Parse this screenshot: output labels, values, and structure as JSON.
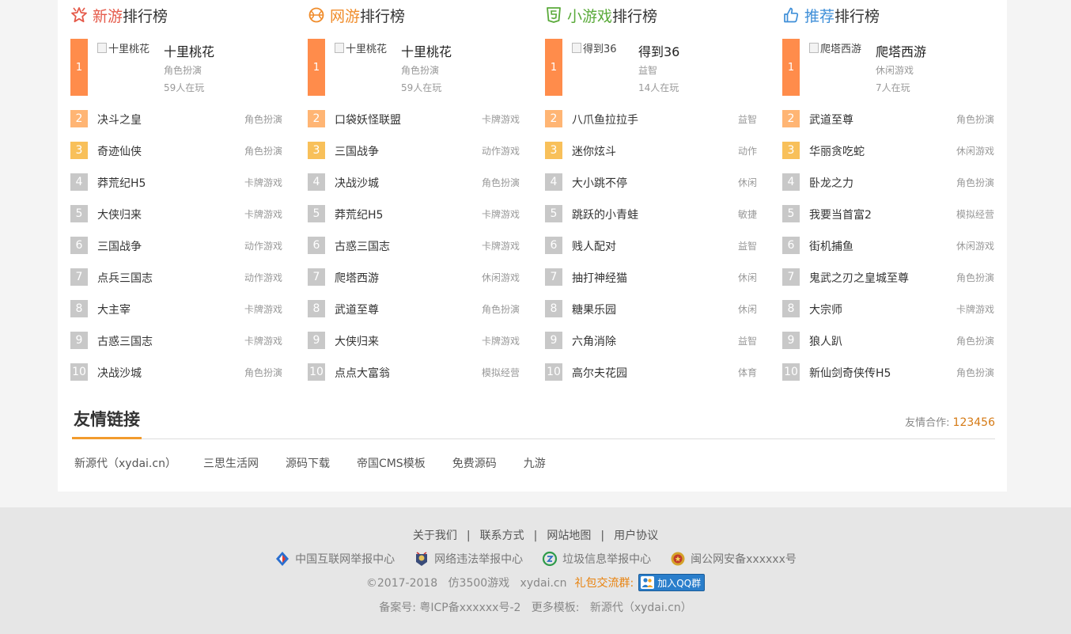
{
  "columns": [
    {
      "title_highlight": "新游",
      "title_rest": "排行榜",
      "highlight_color": "#e55a4a",
      "icon": "star-icon",
      "top": {
        "rank": "1",
        "img_alt": "十里桃花",
        "name": "十里桃花",
        "category": "角色扮演",
        "players": "59人在玩"
      },
      "items": [
        {
          "rank": "2",
          "name": "决斗之皇",
          "category": "角色扮演"
        },
        {
          "rank": "3",
          "name": "奇迹仙侠",
          "category": "角色扮演"
        },
        {
          "rank": "4",
          "name": "莽荒纪H5",
          "category": "卡牌游戏"
        },
        {
          "rank": "5",
          "name": "大侠归来",
          "category": "卡牌游戏"
        },
        {
          "rank": "6",
          "name": "三国战争",
          "category": "动作游戏"
        },
        {
          "rank": "7",
          "name": "点兵三国志",
          "category": "动作游戏"
        },
        {
          "rank": "8",
          "name": "大主宰",
          "category": "卡牌游戏"
        },
        {
          "rank": "9",
          "name": "古惑三国志",
          "category": "卡牌游戏"
        },
        {
          "rank": "10",
          "name": "决战沙城",
          "category": "角色扮演"
        }
      ]
    },
    {
      "title_highlight": "网游",
      "title_rest": "排行榜",
      "highlight_color": "#f08c2a",
      "icon": "basketball-icon",
      "top": {
        "rank": "1",
        "img_alt": "十里桃花",
        "name": "十里桃花",
        "category": "角色扮演",
        "players": "59人在玩"
      },
      "items": [
        {
          "rank": "2",
          "name": "口袋妖怪联盟",
          "category": "卡牌游戏"
        },
        {
          "rank": "3",
          "name": "三国战争",
          "category": "动作游戏"
        },
        {
          "rank": "4",
          "name": "决战沙城",
          "category": "角色扮演"
        },
        {
          "rank": "5",
          "name": "莽荒纪H5",
          "category": "卡牌游戏"
        },
        {
          "rank": "6",
          "name": "古惑三国志",
          "category": "卡牌游戏"
        },
        {
          "rank": "7",
          "name": "爬塔西游",
          "category": "休闲游戏"
        },
        {
          "rank": "8",
          "name": "武道至尊",
          "category": "角色扮演"
        },
        {
          "rank": "9",
          "name": "大侠归来",
          "category": "卡牌游戏"
        },
        {
          "rank": "10",
          "name": "点点大富翁",
          "category": "模拟经营"
        }
      ]
    },
    {
      "title_highlight": "小游戏",
      "title_rest": "排行榜",
      "highlight_color": "#5aaa3a",
      "icon": "html5-icon",
      "top": {
        "rank": "1",
        "img_alt": "得到36",
        "name": "得到36",
        "category": "益智",
        "players": "14人在玩"
      },
      "items": [
        {
          "rank": "2",
          "name": "八爪鱼拉拉手",
          "category": "益智"
        },
        {
          "rank": "3",
          "name": "迷你炫斗",
          "category": "动作"
        },
        {
          "rank": "4",
          "name": "大小跳不停",
          "category": "休闲"
        },
        {
          "rank": "5",
          "name": "跳跃的小青蛙",
          "category": "敏捷"
        },
        {
          "rank": "6",
          "name": "贱人配对",
          "category": "益智"
        },
        {
          "rank": "7",
          "name": "抽打神经猫",
          "category": "休闲"
        },
        {
          "rank": "8",
          "name": "糖果乐园",
          "category": "休闲"
        },
        {
          "rank": "9",
          "name": "六角消除",
          "category": "益智"
        },
        {
          "rank": "10",
          "name": "高尔夫花园",
          "category": "体育"
        }
      ]
    },
    {
      "title_highlight": "推荐",
      "title_rest": "排行榜",
      "highlight_color": "#3f8fd8",
      "icon": "thumbs-up-icon",
      "top": {
        "rank": "1",
        "img_alt": "爬塔西游",
        "name": "爬塔西游",
        "category": "休闲游戏",
        "players": "7人在玩"
      },
      "items": [
        {
          "rank": "2",
          "name": "武道至尊",
          "category": "角色扮演"
        },
        {
          "rank": "3",
          "name": "华丽贪吃蛇",
          "category": "休闲游戏"
        },
        {
          "rank": "4",
          "name": "卧龙之力",
          "category": "角色扮演"
        },
        {
          "rank": "5",
          "name": "我要当首富2",
          "category": "模拟经营"
        },
        {
          "rank": "6",
          "name": "街机捕鱼",
          "category": "休闲游戏"
        },
        {
          "rank": "7",
          "name": "鬼武之刃之皇城至尊",
          "category": "角色扮演"
        },
        {
          "rank": "8",
          "name": "大宗师",
          "category": "卡牌游戏"
        },
        {
          "rank": "9",
          "name": "狼人趴",
          "category": "角色扮演"
        },
        {
          "rank": "10",
          "name": "新仙剑奇侠传H5",
          "category": "角色扮演"
        }
      ]
    }
  ],
  "friend_links": {
    "title": "友情链接",
    "coop_label": "友情合作:",
    "coop_value": "123456",
    "items": [
      "新源代（xydai.cn）",
      "三思生活网",
      "源码下载",
      "帝国CMS模板",
      "免费源码",
      "九游"
    ]
  },
  "footer": {
    "nav": [
      "关于我们",
      "联系方式",
      "网站地图",
      "用户协议"
    ],
    "nav_sep": "|",
    "reports": [
      {
        "icon": "report-center-icon",
        "label": "中国互联网举报中心"
      },
      {
        "icon": "police-report-icon",
        "label": "网络违法举报中心"
      },
      {
        "icon": "spam-report-icon",
        "label": "垃圾信息举报中心"
      },
      {
        "icon": "police-badge-icon",
        "label": "闽公网安备xxxxxx号"
      }
    ],
    "copyright": "©2017-2018   仿3500游戏   xydai.cn",
    "gift_label": "礼包交流群:",
    "qq_button": "加入QQ群",
    "beian": "备案号: 粤ICP备xxxxxx号-2   更多模板:   新源代（xydai.cn）"
  }
}
